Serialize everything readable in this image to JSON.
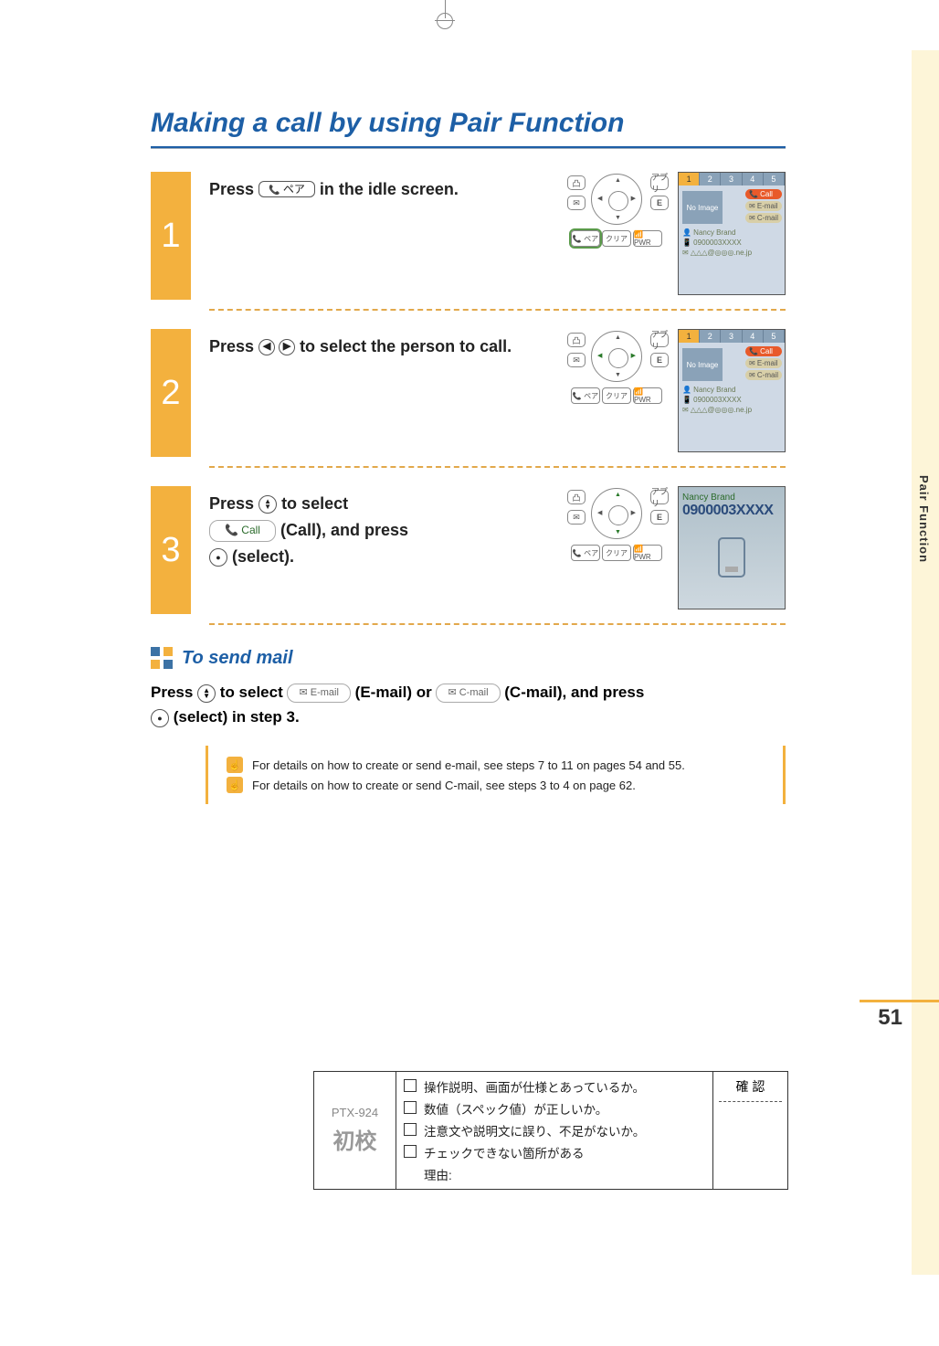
{
  "title": "Making a call by using Pair Function",
  "side_tab": "Pair Function",
  "page_number": "51",
  "steps": {
    "s1": {
      "num": "1",
      "text_a": "Press ",
      "key_label": "ペア",
      "text_b": " in the idle screen."
    },
    "s2": {
      "num": "2",
      "text_a": "Press ",
      "text_b": " to select the person to call."
    },
    "s3": {
      "num": "3",
      "text_a": "Press ",
      "text_b": " to select",
      "call_chip": "📞 Call",
      "text_c": "(Call), and press",
      "text_d": "(select)."
    }
  },
  "key_labels": {
    "softL": "凸",
    "softR": "アプリ",
    "softL2": "✉",
    "softR2": "E",
    "bottom_left": "📞 ペア",
    "bottom_mid": "クリア",
    "bottom_right": "📶 PWR"
  },
  "screen12": {
    "tabs": [
      "1",
      "2",
      "3",
      "4",
      "5"
    ],
    "menu_call": "📞 Call",
    "menu_email": "✉ E-mail",
    "menu_cmail": "✉ C-mail",
    "thumb": "No Image",
    "name": "👤 Nancy Brand",
    "phone": "📱 0900003XXXX",
    "email": "✉ △△△@◎◎◎.ne.jp"
  },
  "screen3": {
    "name": "Nancy Brand",
    "number": "0900003XXXX"
  },
  "subhead": "To send mail",
  "mail_para": {
    "a": "Press ",
    "b": " to select ",
    "email_chip": "✉ E-mail",
    "c": " (E-mail) or ",
    "cmail_chip": "✉ C-mail",
    "d": " (C-mail), and press",
    "e": "(select) in step 3."
  },
  "notes": {
    "n1": "For details on how to create or send e-mail, see steps 7 to 11 on pages 54 and 55.",
    "n2": "For details on how to create or send C-mail, see steps 3 to 4 on page 62."
  },
  "proof": {
    "model": "PTX-924",
    "stage": "初校",
    "confirm": "確 認",
    "check1": "操作説明、画面が仕様とあっているか。",
    "check2": "数値（スペック値）が正しいか。",
    "check3": "注意文や説明文に誤り、不足がないか。",
    "check4": "チェックできない箇所がある",
    "reason": "理由:"
  }
}
